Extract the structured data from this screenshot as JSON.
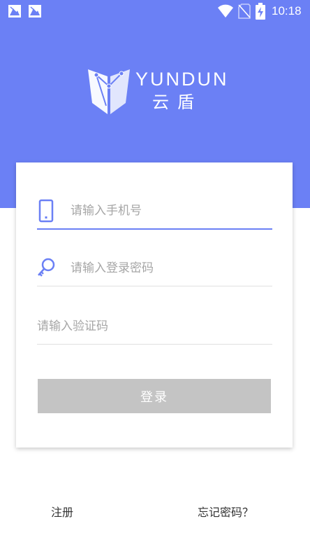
{
  "status_bar": {
    "time": "10:18",
    "icons": [
      "notification-image-icon",
      "notification-image-icon",
      "wifi-icon",
      "no-sim-icon",
      "battery-charging-icon"
    ]
  },
  "brand": {
    "name_en": "YUNDUN",
    "name_cn": "云盾",
    "logo_icon": "shield-logo-icon"
  },
  "form": {
    "phone_placeholder": "请输入手机号",
    "password_placeholder": "请输入登录密码",
    "code_placeholder": "请输入验证码",
    "login_label": "登录"
  },
  "links": {
    "register": "注册",
    "forgot": "忘记密码？"
  },
  "colors": {
    "accent": "#6B80F5",
    "button_disabled": "#C4C4C4",
    "placeholder": "#A6A6A6"
  }
}
